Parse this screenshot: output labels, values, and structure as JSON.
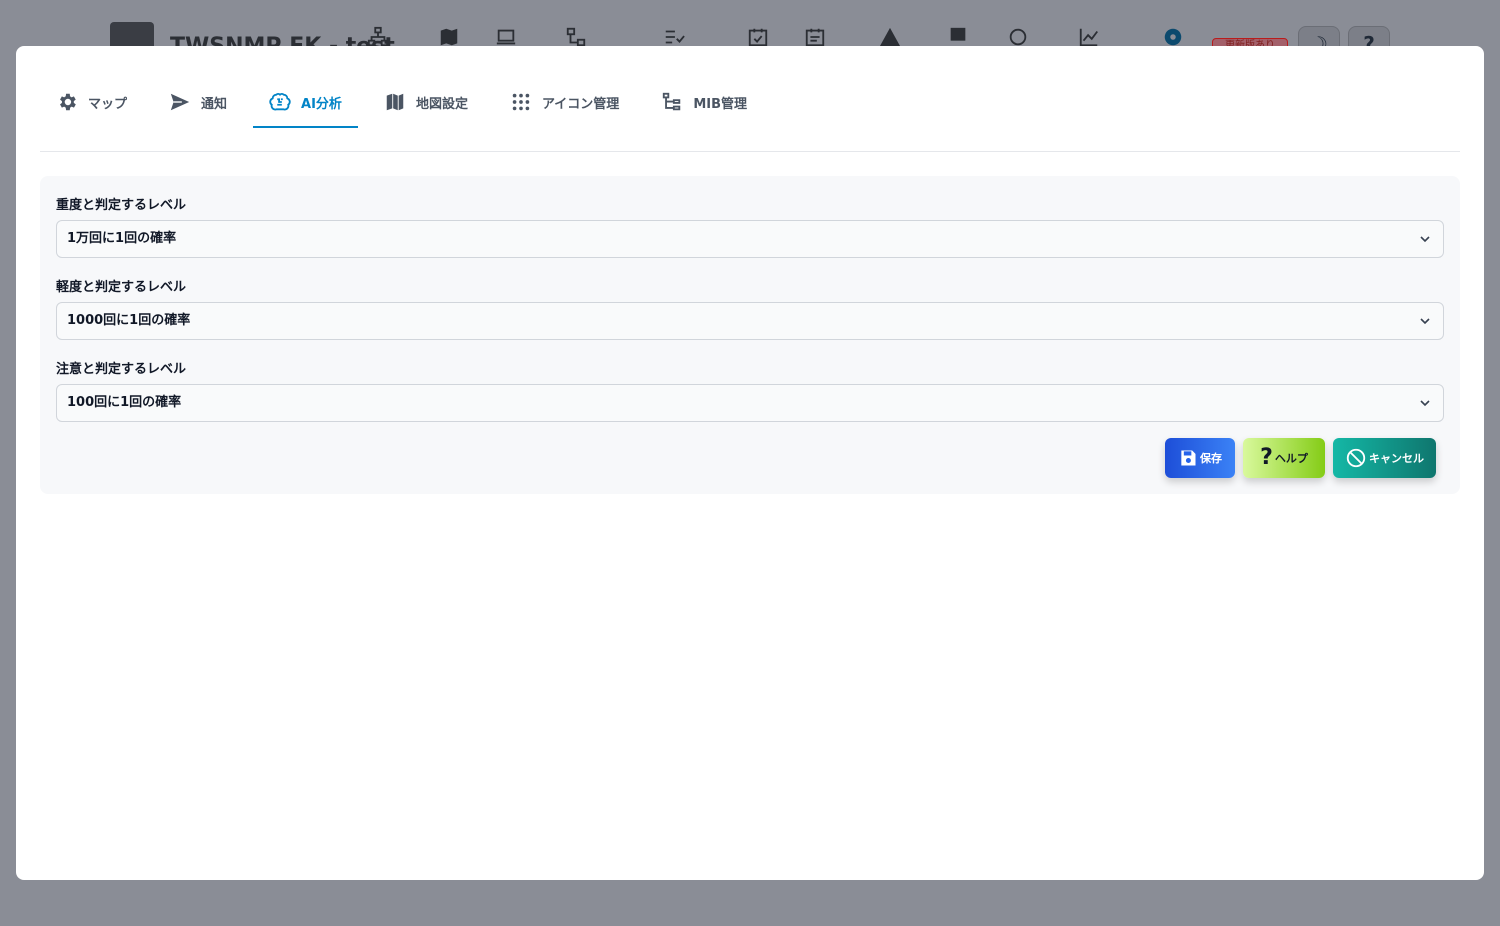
{
  "background": {
    "app_title": "TWSNMP FK - test",
    "update_badge": "更新版あり",
    "help_button": "?",
    "theme_button": "☽"
  },
  "tabs": [
    {
      "label": "マップ",
      "icon": "gear-icon",
      "active": false
    },
    {
      "label": "通知",
      "icon": "send-icon",
      "active": false
    },
    {
      "label": "AI分析",
      "icon": "brain-icon",
      "active": true
    },
    {
      "label": "地図設定",
      "icon": "map-icon",
      "active": false
    },
    {
      "label": "アイコン管理",
      "icon": "grid-icon",
      "active": false
    },
    {
      "label": "MIB管理",
      "icon": "tree-icon",
      "active": false
    }
  ],
  "form": {
    "high": {
      "label": "重度と判定するレベル",
      "value": "1万回に1回の確率"
    },
    "low": {
      "label": "軽度と判定するレベル",
      "value": "1000回に1回の確率"
    },
    "warn": {
      "label": "注意と判定するレベル",
      "value": "100回に1回の確率"
    }
  },
  "buttons": {
    "save": "保存",
    "help": "ヘルプ",
    "cancel": "キャンセル"
  },
  "colors": {
    "accent": "#0284c7",
    "save": "#2563eb",
    "help": "#a3e635",
    "cancel": "#0d9488"
  }
}
